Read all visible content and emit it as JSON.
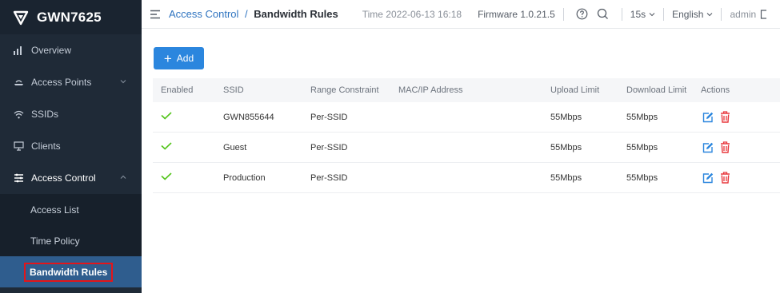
{
  "brand": {
    "name": "GWN7625"
  },
  "sidebar": {
    "items": [
      {
        "label": "Overview",
        "icon": "bar-chart-icon"
      },
      {
        "label": "Access Points",
        "icon": "access-point-icon"
      },
      {
        "label": "SSIDs",
        "icon": "wifi-icon"
      },
      {
        "label": "Clients",
        "icon": "clients-icon"
      },
      {
        "label": "Access Control",
        "icon": "access-control-icon"
      }
    ],
    "sub_items": [
      {
        "label": "Access List"
      },
      {
        "label": "Time Policy"
      },
      {
        "label": "Bandwidth Rules"
      }
    ]
  },
  "header": {
    "breadcrumb_parent": "Access Control",
    "breadcrumb_sep": "/",
    "breadcrumb_current": "Bandwidth Rules",
    "time": "Time 2022-06-13 16:18",
    "firmware": "Firmware 1.0.21.5",
    "refresh": "15s",
    "language": "English",
    "user": "admin"
  },
  "main": {
    "add_label": "Add",
    "columns": [
      "Enabled",
      "SSID",
      "Range Constraint",
      "MAC/IP Address",
      "Upload Limit",
      "Download Limit",
      "Actions"
    ],
    "rows": [
      {
        "ssid": "GWN855644",
        "range": "Per-SSID",
        "mac": "",
        "upload": "55Mbps",
        "download": "55Mbps"
      },
      {
        "ssid": "Guest",
        "range": "Per-SSID",
        "mac": "",
        "upload": "55Mbps",
        "download": "55Mbps"
      },
      {
        "ssid": "Production",
        "range": "Per-SSID",
        "mac": "",
        "upload": "55Mbps",
        "download": "55Mbps"
      }
    ]
  },
  "colors": {
    "accent": "#2b86de",
    "sidebar_bg": "#1f2a37",
    "selected_bg": "#2f5d8e",
    "enabled_green": "#52c41a",
    "delete_red": "#e8383d",
    "highlight_red": "#e3151a"
  }
}
